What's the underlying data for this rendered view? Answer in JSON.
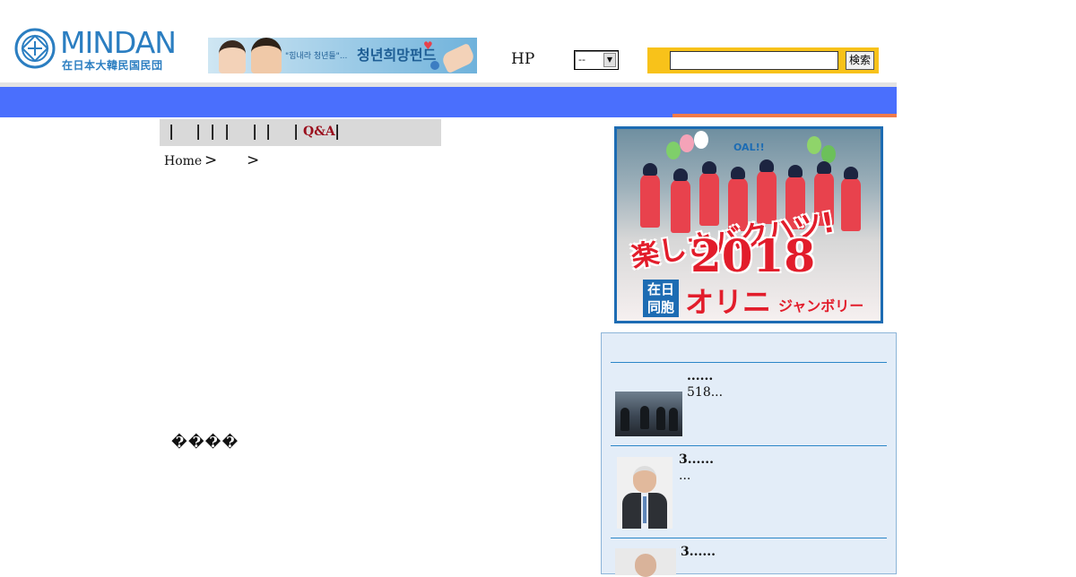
{
  "header": {
    "logo_text": "MINDAN",
    "logo_subtext": "在日本大韓民国民団",
    "banner": {
      "small_text": "\"힘내라 청년들\"...",
      "big_text": "청년희망펀드"
    },
    "hp_label": "HP",
    "select_value": "--",
    "search_value": "",
    "search_button_label": "検索"
  },
  "submenu": {
    "separators": [
      "|",
      "|",
      "|",
      "|",
      "|",
      "|",
      "|",
      "|"
    ],
    "qa_label": "Q&A"
  },
  "breadcrumb": {
    "home_label": "Home",
    "arrow1": ">",
    "arrow2": ">"
  },
  "main": {
    "garbled_text": "����"
  },
  "promo": {
    "line1": "楽しさバクハツ!",
    "year": "2018",
    "box_text_1": "在日",
    "box_text_2": "同胞",
    "name": "オリニ",
    "subtitle": "ジャンボリー",
    "banner_text": "OAL!!"
  },
  "news": {
    "items": [
      {
        "title": "......",
        "desc": "518..."
      },
      {
        "title": "3......",
        "desc": "..."
      },
      {
        "title": "3......",
        "desc": ""
      }
    ]
  },
  "colors": {
    "nav_blue": "#4a6ffd",
    "nav_accent": "#f07a4a",
    "search_bg": "#f8c21a",
    "qa_red": "#9a0f1d",
    "logo_blue": "#2b7ec1",
    "news_bg": "#e3edf8"
  },
  "icons": {
    "logo_emblem": "mindan-emblem-icon",
    "select_arrow": "chevron-down-icon"
  }
}
